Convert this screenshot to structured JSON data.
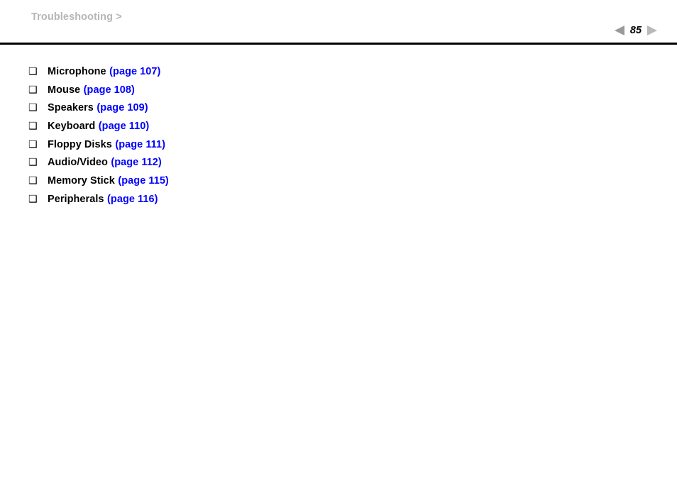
{
  "header": {
    "breadcrumb_label": "Troubleshooting",
    "breadcrumb_separator": ">"
  },
  "pager": {
    "prev_icon": "triangle-left-icon",
    "next_icon": "triangle-right-icon",
    "current_page": "85",
    "prev_color": "#9a9a9a",
    "next_color": "#b9b9b9"
  },
  "colors": {
    "breadcrumb": "#b6b6b6",
    "link": "#0000ff",
    "text": "#000000",
    "rule": "#000000",
    "background": "#ffffff"
  },
  "content": {
    "bullet_glyph": "❑",
    "items": [
      {
        "label": "Microphone",
        "pageref": "(page 107)"
      },
      {
        "label": "Mouse",
        "pageref": "(page 108)"
      },
      {
        "label": "Speakers",
        "pageref": "(page 109)"
      },
      {
        "label": "Keyboard",
        "pageref": "(page 110)"
      },
      {
        "label": "Floppy Disks",
        "pageref": "(page 111)"
      },
      {
        "label": "Audio/Video",
        "pageref": "(page 112)"
      },
      {
        "label": "Memory Stick",
        "pageref": "(page 115)"
      },
      {
        "label": "Peripherals",
        "pageref": "(page 116)"
      }
    ]
  }
}
